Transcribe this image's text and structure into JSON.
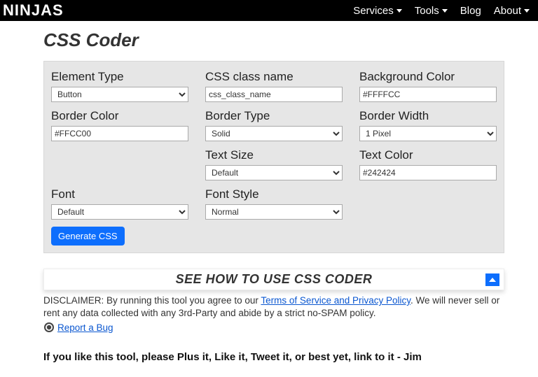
{
  "nav": {
    "brand": "NINJAS",
    "items": [
      {
        "label": "Services",
        "has_menu": true
      },
      {
        "label": "Tools",
        "has_menu": true
      },
      {
        "label": "Blog",
        "has_menu": false
      },
      {
        "label": "About",
        "has_menu": true
      }
    ]
  },
  "page": {
    "title": "CSS Coder"
  },
  "form": {
    "element_type": {
      "label": "Element Type",
      "value": "Button"
    },
    "css_class_name": {
      "label": "CSS class name",
      "value": "css_class_name"
    },
    "background_color": {
      "label": "Background Color",
      "value": "#FFFFCC"
    },
    "border_color": {
      "label": "Border Color",
      "value": "#FFCC00"
    },
    "border_type": {
      "label": "Border Type",
      "value": "Solid"
    },
    "border_width": {
      "label": "Border Width",
      "value": "1 Pixel"
    },
    "text_size": {
      "label": "Text Size",
      "value": "Default"
    },
    "text_color": {
      "label": "Text Color",
      "value": "#242424"
    },
    "font": {
      "label": "Font",
      "value": "Default"
    },
    "font_style": {
      "label": "Font Style",
      "value": "Normal"
    },
    "generate_label": "Generate CSS"
  },
  "seehow": {
    "text": "SEE HOW TO USE CSS CODER"
  },
  "disclaimer": {
    "prefix": "DISCLAIMER: By running this tool you agree to our ",
    "link_text": "Terms of Service and Privacy Policy",
    "suffix": ". We will never sell or rent any data collected with any 3rd-Party and abide by a strict no-SPAM policy."
  },
  "bug": {
    "link_text": "Report a Bug"
  },
  "like_line": "If you like this tool, please Plus it, Like it, Tweet it, or best yet, link to it - Jim"
}
